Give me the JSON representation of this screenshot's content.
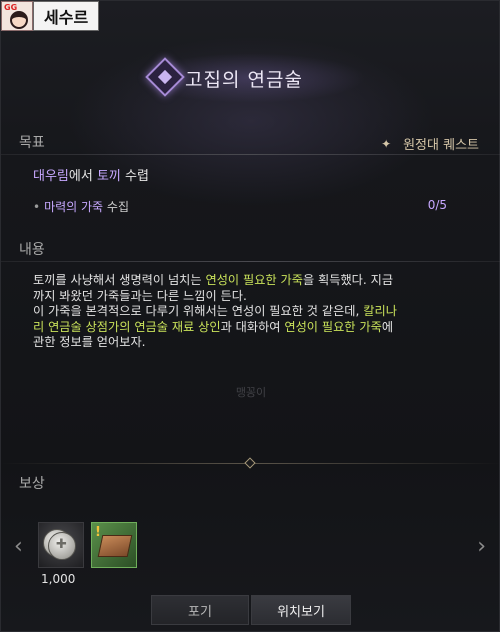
{
  "tag": {
    "corner_mark": "GG",
    "label": "세수르"
  },
  "quest": {
    "title": "고집의 연금술",
    "type": "원정대 퀘스트"
  },
  "sections": {
    "goal": "목표",
    "content": "내용",
    "reward": "보상"
  },
  "goal": {
    "main_place": "대우림",
    "main_mid": "에서 ",
    "main_target": "토끼",
    "main_end": " 수렵",
    "sub_item": "마력의 가죽",
    "sub_action": " 수집",
    "progress": "0/5"
  },
  "content": {
    "l1_a": "토끼를 사냥해서 생명력이 넘치는 ",
    "l1_hl": "연성이 필요한 가죽",
    "l1_b": "을 획득했다. 지금",
    "l2": "까지 봐왔던 가죽들과는 다른 느낌이 든다.",
    "l3_a": "이 가죽을 본격적으로 다루기 위해서는 연성이 필요한 것 같은데, ",
    "l3_hl": "칼리나",
    "l4_hl1": "리 연금술 상점가의 연금술 재료 상인",
    "l4_a": "과 대화하여 ",
    "l4_hl2": "연성이 필요한 가죽",
    "l4_b": "에",
    "l5": "관한 정보를 얻어보자."
  },
  "background_text": "맹꽁이",
  "rewards": {
    "items": [
      {
        "icon": "silver-coins-icon",
        "quantity": "1,000"
      },
      {
        "icon": "leather-material-icon",
        "quantity": ""
      }
    ]
  },
  "buttons": {
    "cancel": "포기",
    "locate": "위치보기"
  },
  "colors": {
    "highlight_purple": "#c7a8ff",
    "highlight_green": "#c9e25a",
    "quest_type": "#d5c6a8"
  }
}
